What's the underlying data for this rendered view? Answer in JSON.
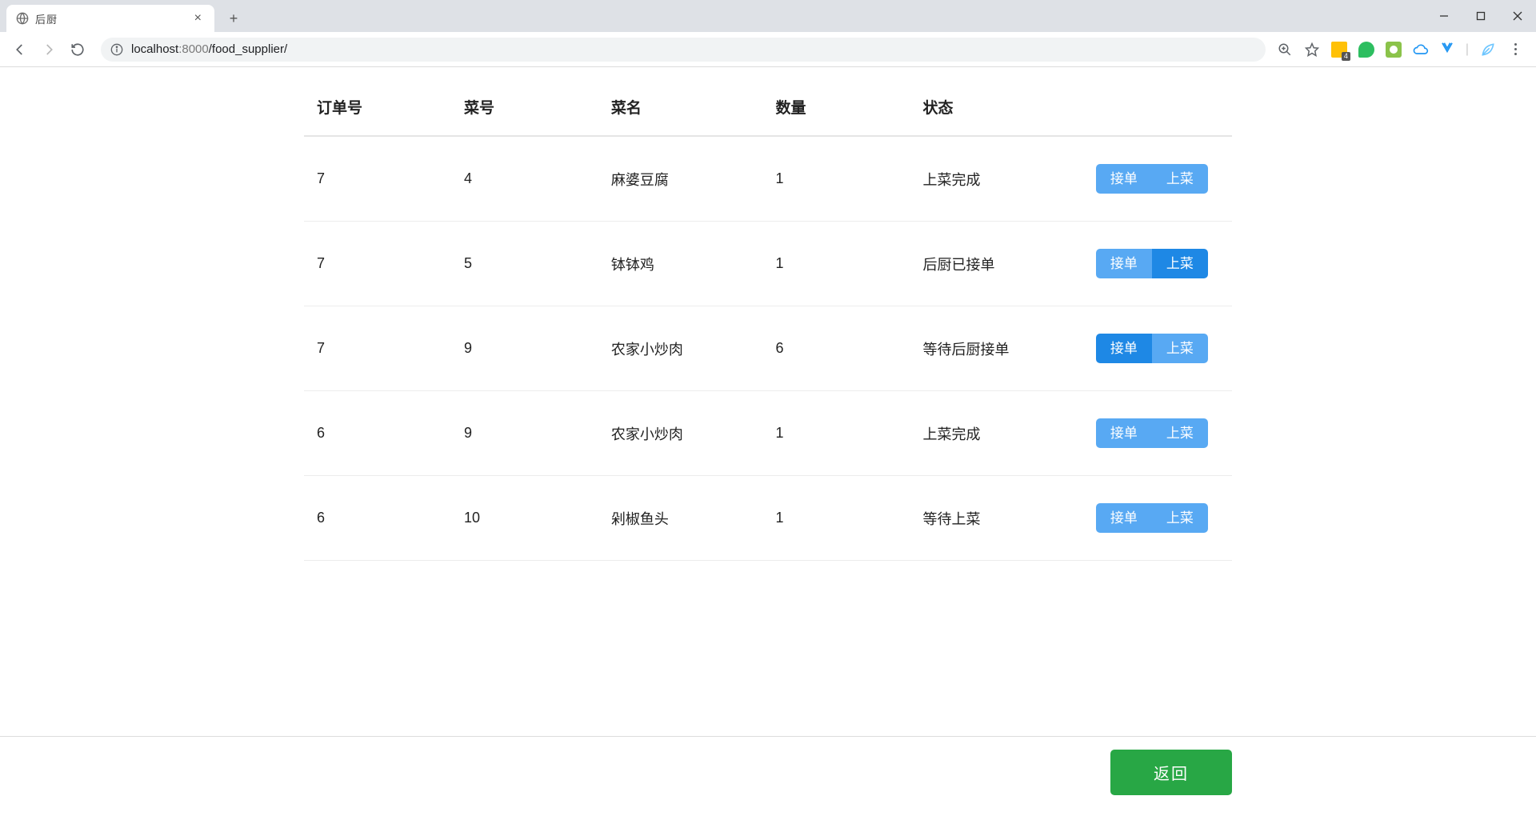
{
  "browser": {
    "tab_title": "后厨",
    "url_host": "localhost",
    "url_port_path": ":8000",
    "url_path": "/food_supplier/",
    "ext_badge": "4"
  },
  "table": {
    "headers": {
      "order_id": "订单号",
      "dish_id": "菜号",
      "dish_name": "菜名",
      "quantity": "数量",
      "status": "状态"
    },
    "rows": [
      {
        "order_id": "7",
        "dish_id": "4",
        "dish_name": "麻婆豆腐",
        "quantity": "1",
        "status": "上菜完成",
        "accept_active": false,
        "serve_active": false
      },
      {
        "order_id": "7",
        "dish_id": "5",
        "dish_name": "钵钵鸡",
        "quantity": "1",
        "status": "后厨已接单",
        "accept_active": false,
        "serve_active": true
      },
      {
        "order_id": "7",
        "dish_id": "9",
        "dish_name": "农家小炒肉",
        "quantity": "6",
        "status": "等待后厨接单",
        "accept_active": true,
        "serve_active": false
      },
      {
        "order_id": "6",
        "dish_id": "9",
        "dish_name": "农家小炒肉",
        "quantity": "1",
        "status": "上菜完成",
        "accept_active": false,
        "serve_active": false
      },
      {
        "order_id": "6",
        "dish_id": "10",
        "dish_name": "剁椒鱼头",
        "quantity": "1",
        "status": "等待上菜",
        "accept_active": false,
        "serve_active": false
      }
    ]
  },
  "buttons": {
    "accept": "接单",
    "serve": "上菜",
    "return": "返回"
  }
}
